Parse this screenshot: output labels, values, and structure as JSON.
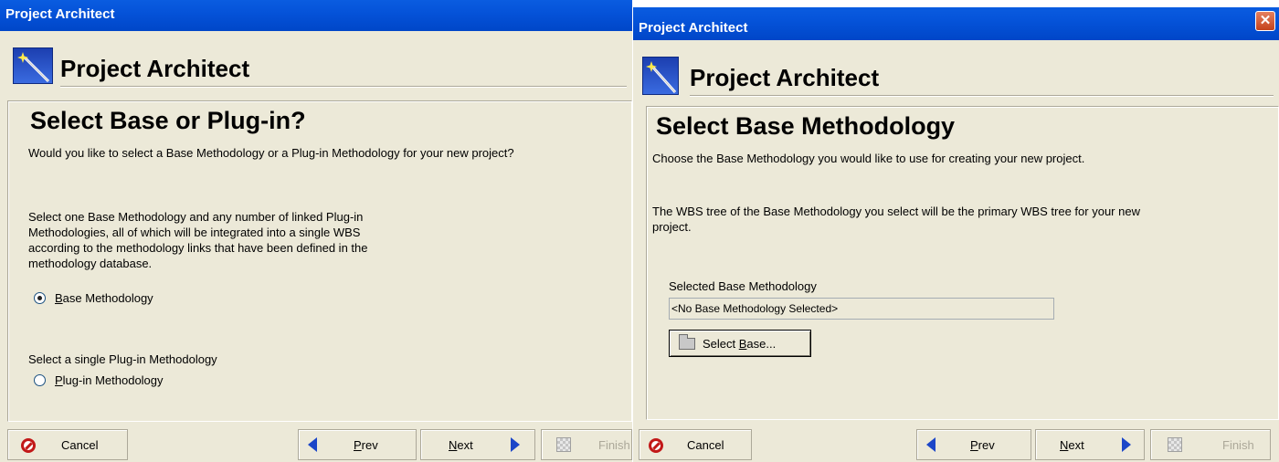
{
  "left": {
    "window_title": "Project Architect",
    "header_title": "Project Architect",
    "step_title": "Select Base or Plug-in?",
    "question": "Would you like to select a Base Methodology or a Plug-in Methodology for your new project?",
    "base_desc": [
      "Select one Base Methodology and any number of linked Plug-in",
      "Methodologies, all of which will be integrated into a single WBS",
      "according to the methodology links that have been defined in the",
      "methodology database."
    ],
    "base_option": {
      "mnemonic": "B",
      "rest": "ase Methodology",
      "selected": true
    },
    "plugin_desc": "Select a single Plug-in Methodology",
    "plugin_option": {
      "mnemonic": "P",
      "rest": "lug-in Methodology",
      "selected": false
    },
    "footer": {
      "cancel": "Cancel",
      "prev_mnemonic": "P",
      "prev_rest": "rev",
      "next_mnemonic": "N",
      "next_rest": "ext",
      "finish": "Finish"
    }
  },
  "right": {
    "window_title": "Project Architect",
    "close_glyph": "✕",
    "header_title": "Project Architect",
    "step_title": "Select Base Methodology",
    "intro": "Choose the Base Methodology you would like to use for creating your new project.",
    "wbs_note": [
      "The WBS tree of the Base Methodology you select will be the primary WBS tree for your new",
      "project."
    ],
    "selected_label": "Selected Base Methodology",
    "selected_value": "<No Base Methodology Selected>",
    "select_button": {
      "pre": "Select ",
      "mnemonic": "B",
      "rest": "ase..."
    },
    "footer": {
      "cancel": "Cancel",
      "prev_mnemonic": "P",
      "prev_rest": "rev",
      "next_mnemonic": "N",
      "next_rest": "ext",
      "finish": "Finish"
    }
  },
  "colors": {
    "title_bar": "#0553d9",
    "dialog_bg": "#ece9d8",
    "arrow": "#1c46c8",
    "cancel": "#c21818"
  },
  "icons": {
    "wizard": "magic-wand-icon",
    "cancel": "cancel-icon",
    "prev": "arrow-left-icon",
    "next": "arrow-right-icon",
    "finish": "finish-icon",
    "folder": "folder-icon",
    "close": "close-icon"
  }
}
